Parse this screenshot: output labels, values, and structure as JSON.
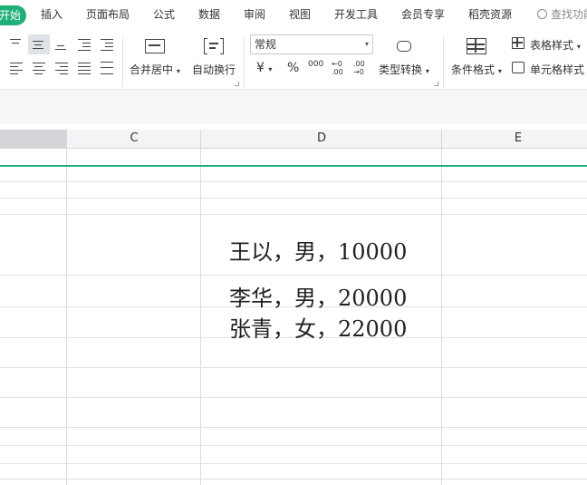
{
  "menu": {
    "active_tab": "开始",
    "tabs": [
      "插入",
      "页面布局",
      "公式",
      "数据",
      "审阅",
      "视图",
      "开发工具",
      "会员专享",
      "稻壳资源"
    ],
    "search_placeholder": "查找功能"
  },
  "ribbon": {
    "merge_center": "合并居中",
    "auto_wrap": "自动换行",
    "number_format": "常规",
    "currency_symbol": "¥",
    "percent_symbol": "%",
    "thousands_symbol": "000",
    "increase_decimal": "←0 .00",
    "decrease_decimal": ".00 →0",
    "type_convert": "类型转换",
    "conditional_format": "条件格式",
    "table_style": "表格样式",
    "cell_style": "单元格样式"
  },
  "sheet": {
    "columns": [
      "C",
      "D",
      "E"
    ],
    "cells": [
      {
        "ref": "D",
        "text": "王以，男，10000"
      },
      {
        "ref": "D",
        "text": "李华，男，20000"
      },
      {
        "ref": "D",
        "text": "张青，女，22000"
      }
    ]
  },
  "colors": {
    "accent": "#1fb079",
    "grid": "#d9dbde",
    "selected_column_header": "#d4d6da"
  }
}
